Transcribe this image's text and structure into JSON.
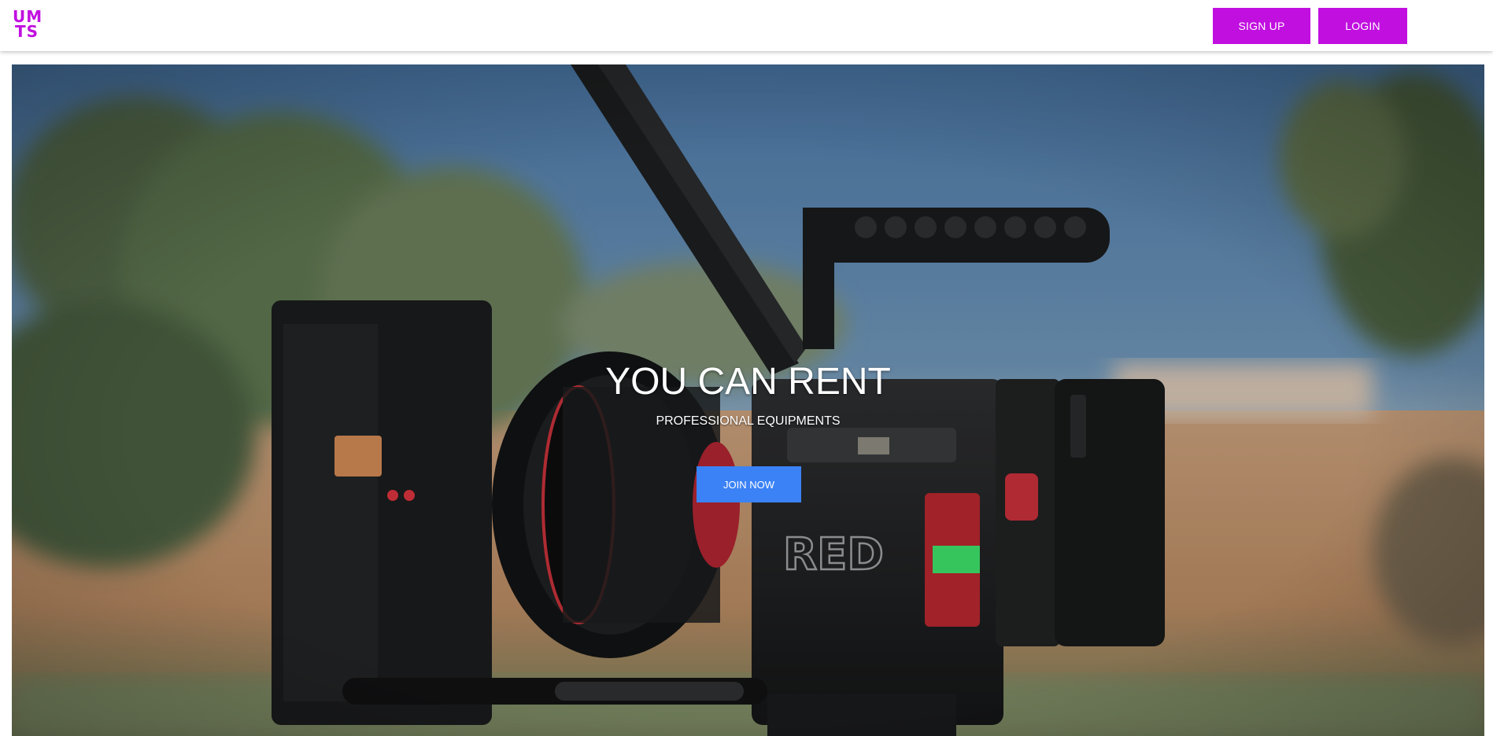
{
  "header": {
    "logo_line1": "UM",
    "logo_line2": "TS",
    "signup_label": "SIGN UP",
    "login_label": "LOGIN"
  },
  "hero": {
    "image": "hero-camera-image",
    "title": "YOU CAN RENT",
    "subtitle": "PROFESSIONAL EQUIPMENTS",
    "cta_label": "JOIN NOW"
  },
  "colors": {
    "brand": "#c10fe0",
    "cta": "#3b82f6",
    "header_bg": "#ffffff"
  }
}
